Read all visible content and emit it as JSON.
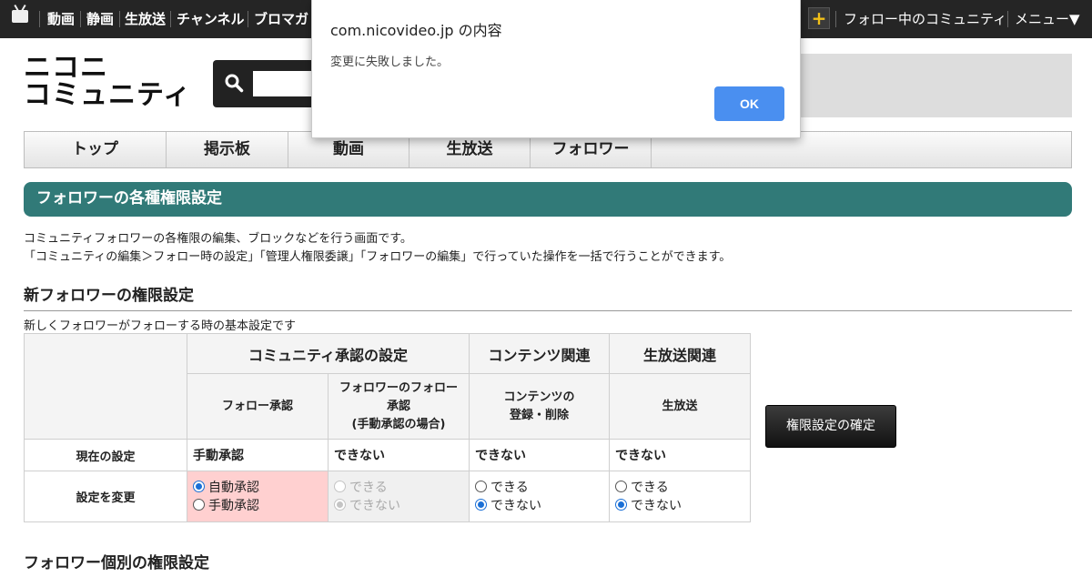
{
  "topbar": {
    "nav": [
      "動画",
      "静画",
      "生放送",
      "チャンネル",
      "ブロマガ"
    ],
    "plus_label": "+",
    "following_community": "フォロー中のコミュニティ",
    "menu": "メニュー▼"
  },
  "logo": {
    "line1": "ニコニ",
    "line2": "コミュニティ"
  },
  "nav_tabs": [
    "トップ",
    "掲示板",
    "動画",
    "生放送",
    "フォロワー"
  ],
  "section_title": "フォロワーの各種権限設定",
  "description": [
    "コミュニティフォロワーの各権限の編集、ブロックなどを行う画面です。",
    "「コミュニティの編集＞フォロー時の設定」「管理人権限委譲」「フォロワーの編集」で行っていた操作を一括で行うことができます。"
  ],
  "new_follower_heading": "新フォロワーの権限設定",
  "new_follower_sub": "新しくフォロワーがフォローする時の基本設定です",
  "table": {
    "group_headers": [
      "コミュニティ承認の設定",
      "コンテンツ関連",
      "生放送関連"
    ],
    "col_headers": [
      "フォロー承認",
      "フォロワーのフォロー承認",
      "(手動承認の場合)",
      "コンテンツの",
      "登録・削除",
      "生放送"
    ],
    "row_current": "現在の設定",
    "row_change": "設定を変更",
    "current_values": [
      "手動承認",
      "できない",
      "できない",
      "できない"
    ],
    "options": {
      "auto": "自動承認",
      "manual": "手動承認",
      "can": "できる",
      "cannot": "できない"
    }
  },
  "confirm_button": "権限設定の確定",
  "individual_heading": "フォロワー個別の権限設定",
  "dialog": {
    "title": "com.nicovideo.jp の内容",
    "message": "変更に失敗しました。",
    "ok": "OK"
  },
  "colors": {
    "topbar": "#252525",
    "section_header": "#317a78",
    "highlight_cell": "#ffd0d0",
    "dialog_ok": "#4a8ff0"
  }
}
